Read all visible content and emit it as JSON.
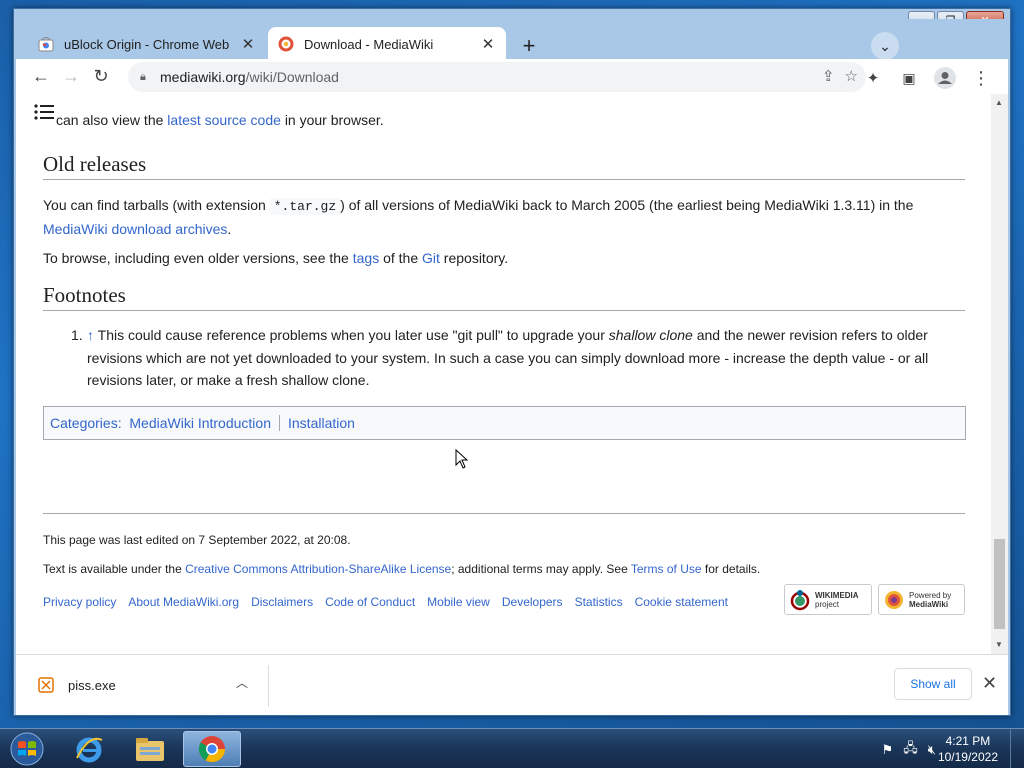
{
  "browser": {
    "tabs": [
      {
        "title": "uBlock Origin - Chrome Web Store",
        "active": false
      },
      {
        "title": "Download - MediaWiki",
        "active": true
      }
    ],
    "address": {
      "domain": "mediawiki.org",
      "path": "/wiki/Download"
    }
  },
  "page": {
    "intro_prefix": "can also view the",
    "intro_link": "latest source code",
    "intro_suffix": "in your browser.",
    "old_releases": {
      "heading": "Old releases",
      "p1_a": "You can find tarballs (with extension",
      "p1_code": "*.tar.gz",
      "p1_b": ") of all versions of MediaWiki back to March 2005 (the earliest being MediaWiki 1.3.11) in the",
      "p1_link": "MediaWiki download archives",
      "p1_c": ".",
      "p2_a": "To browse, including even older versions, see the",
      "p2_link1": "tags",
      "p2_b": "of the",
      "p2_link2": "Git",
      "p2_c": "repository."
    },
    "footnotes": {
      "heading": "Footnotes",
      "items": [
        {
          "num": "1.",
          "arrow": "↑",
          "text_a": "This could cause reference problems when you later use \"git pull\" to upgrade your",
          "text_em": "shallow clone",
          "text_b": "and the newer revision refers to older revisions which are not yet downloaded to your system. In such a case you can simply download more - increase the depth value - or all revisions later, or make a fresh shallow clone."
        }
      ]
    },
    "categories": {
      "label": "Categories",
      "items": [
        "MediaWiki Introduction",
        "Installation"
      ]
    },
    "footer": {
      "last_edited": "This page was last edited on 7 September 2022, at 20:08.",
      "license_a": "Text is available under the",
      "license_link": "Creative Commons Attribution-ShareAlike License",
      "license_b": "; additional terms may apply. See",
      "terms_link": "Terms of Use",
      "license_c": "for details.",
      "links": [
        "Privacy policy",
        "About MediaWiki.org",
        "Disclaimers",
        "Code of Conduct",
        "Mobile view",
        "Developers",
        "Statistics",
        "Cookie statement"
      ],
      "badge_wikimedia_1": "WIKIMEDIA",
      "badge_wikimedia_2": "project",
      "badge_powered_1": "Powered by",
      "badge_powered_2": "MediaWiki"
    }
  },
  "download_bar": {
    "file": "piss.exe",
    "show_all": "Show all"
  },
  "taskbar": {
    "time": "4:21 PM",
    "date": "10/19/2022"
  },
  "colors": {
    "link": "#3366cc",
    "chrome_frame": "#a9c8e8",
    "taskbar": "#1a3558"
  }
}
